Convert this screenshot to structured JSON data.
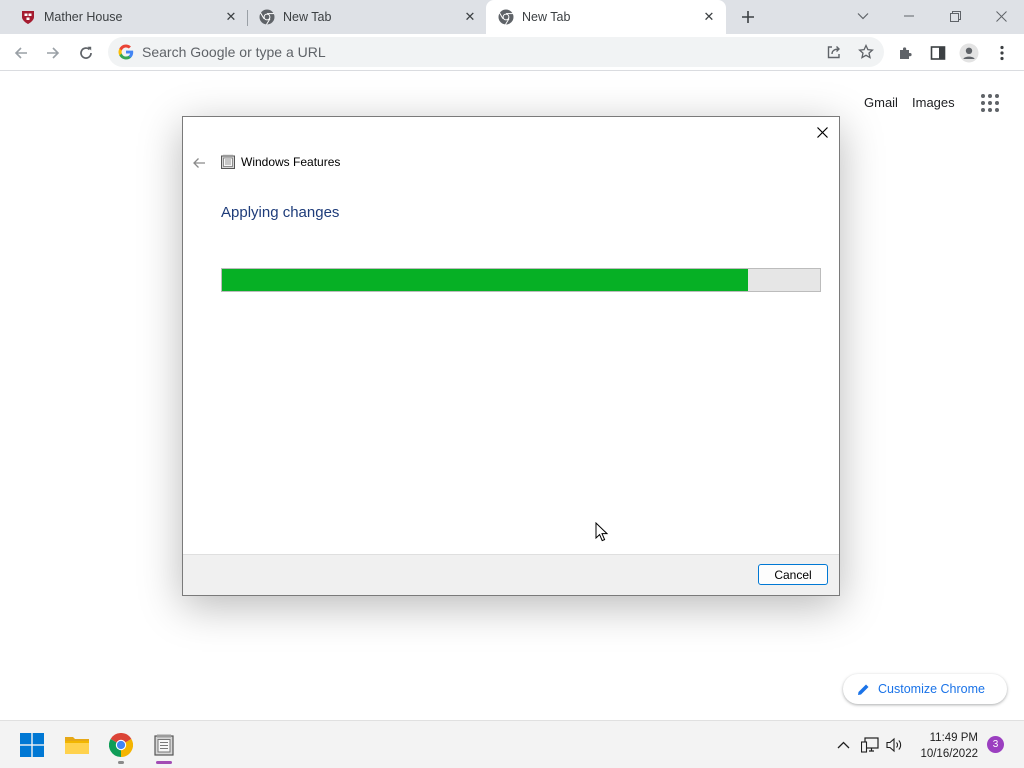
{
  "browser": {
    "tabs": [
      {
        "title": "Mather House",
        "favicon": "harvard-shield-icon",
        "active": false
      },
      {
        "title": "New Tab",
        "favicon": "chrome-icon",
        "active": false
      },
      {
        "title": "New Tab",
        "favicon": "chrome-icon",
        "active": true
      }
    ],
    "omnibox": {
      "placeholder": "Search Google or type a URL"
    }
  },
  "ntp": {
    "gmail_label": "Gmail",
    "images_label": "Images",
    "customize_label": "Customize Chrome"
  },
  "dialog": {
    "title": "Windows Features",
    "heading": "Applying changes",
    "progress": 0.88,
    "progress_color": "#06b025",
    "cancel_label": "Cancel"
  },
  "taskbar": {
    "apps": [
      "windows-start-icon",
      "file-explorer-icon",
      "chrome-icon",
      "windows-features-icon"
    ],
    "time": "11:49 PM",
    "date": "10/16/2022",
    "notification_count": "3"
  }
}
